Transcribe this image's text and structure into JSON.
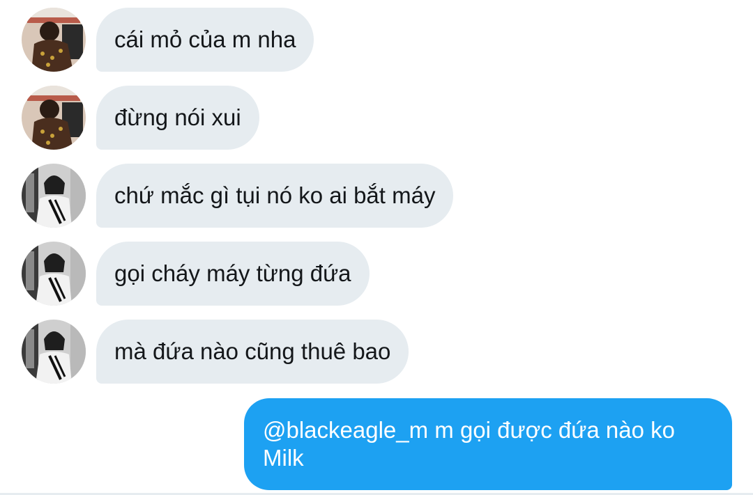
{
  "colors": {
    "incoming_bubble": "#e6ecf0",
    "outgoing_bubble": "#1da1f2",
    "incoming_text": "#14171a",
    "outgoing_text": "#ffffff"
  },
  "messages": [
    {
      "direction": "incoming",
      "avatar": "avatar-dark-jacket",
      "text": "cái mỏ của m nha"
    },
    {
      "direction": "incoming",
      "avatar": "avatar-dark-jacket",
      "text": "đừng nói xui"
    },
    {
      "direction": "incoming",
      "avatar": "avatar-white-shirt",
      "text": "chứ mắc gì tụi nó ko ai bắt máy"
    },
    {
      "direction": "incoming",
      "avatar": "avatar-white-shirt",
      "text": "gọi cháy máy từng đứa"
    },
    {
      "direction": "incoming",
      "avatar": "avatar-white-shirt",
      "text": "mà đứa nào cũng thuê bao"
    },
    {
      "direction": "outgoing",
      "text": "@blackeagle_m m gọi được đứa nào ko Milk"
    }
  ]
}
